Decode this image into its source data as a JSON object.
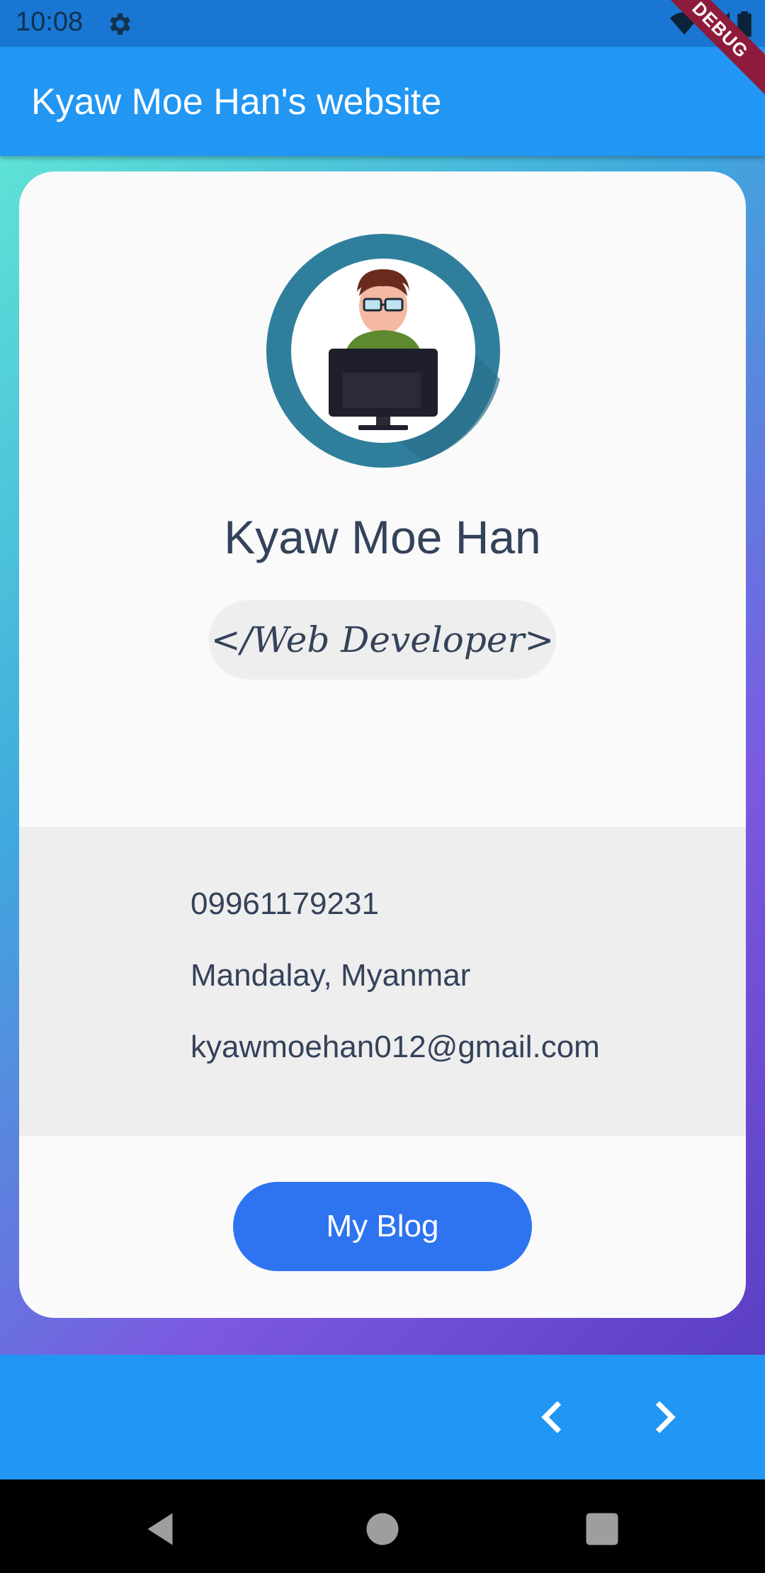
{
  "status_bar": {
    "time": "10:08",
    "icons": [
      "gear-icon",
      "wifi-icon",
      "signal-icon",
      "battery-icon"
    ]
  },
  "debug_banner": "DEBUG",
  "app_bar": {
    "title": "Kyaw Moe Han's website"
  },
  "profile": {
    "name": "Kyaw Moe Han",
    "role": "</Web Developer>",
    "avatar_icon": "developer-avatar-icon"
  },
  "contact": {
    "phone": "09961179231",
    "location": "Mandalay, Myanmar",
    "email": "kyawmoehan012@gmail.com"
  },
  "actions": {
    "blog_label": "My Blog"
  },
  "bottom_nav": {
    "icons": [
      "chevron-left-icon",
      "chevron-right-icon"
    ]
  },
  "system_nav": {
    "icons": [
      "back-icon",
      "home-icon",
      "recents-icon"
    ]
  },
  "colors": {
    "app_bar": "#2196F3",
    "status_bar": "#1976D2",
    "button": "#2E74F0",
    "text": "#34425A",
    "card": "#FAFAFA",
    "info_band": "#EEEEEE"
  }
}
